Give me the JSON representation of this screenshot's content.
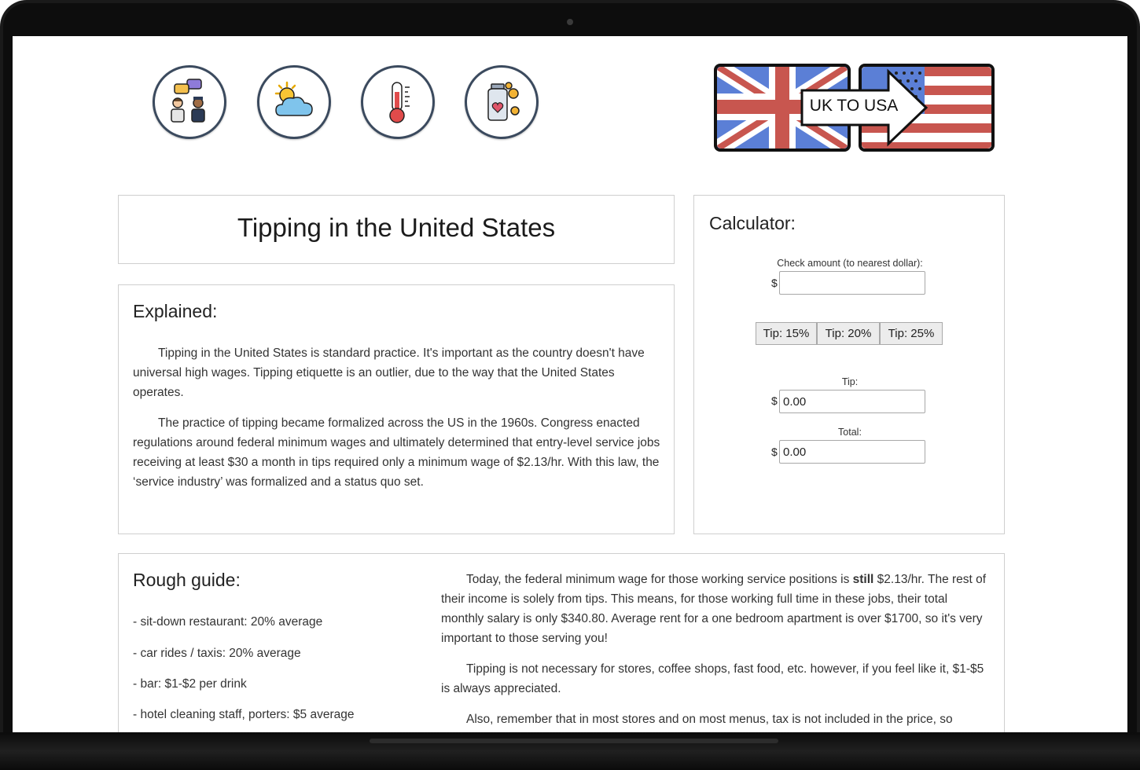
{
  "icons": [
    {
      "name": "conversation-people-icon"
    },
    {
      "name": "weather-sun-cloud-icon"
    },
    {
      "name": "thermometer-icon"
    },
    {
      "name": "tip-jar-icon"
    }
  ],
  "badge": {
    "text": "UK TO USA"
  },
  "title": "Tipping in the United States",
  "explained": {
    "heading": "Explained:",
    "paragraphs": [
      "Tipping in the United States is standard practice. It's important as the country doesn't have universal high wages. Tipping etiquette is an outlier, due to the way that the United States operates.",
      "The practice of tipping became formalized across the US in the 1960s. Congress enacted regulations around federal minimum wages and ultimately determined that entry-level service jobs receiving at least $30 a month in tips required only a minimum wage of $2.13/hr. With this law, the ‘service industry’ was formalized and a status quo set."
    ]
  },
  "calculator": {
    "heading": "Calculator:",
    "check_label": "Check amount (to nearest dollar):",
    "currency": "$",
    "check_value": "",
    "buttons": [
      "Tip: 15%",
      "Tip: 20%",
      "Tip: 25%"
    ],
    "tip_label": "Tip:",
    "tip_value": "0.00",
    "total_label": "Total:",
    "total_value": "0.00"
  },
  "guide": {
    "heading": "Rough guide:",
    "items": [
      "- sit-down restaurant: 20% average",
      "- car rides / taxis: 20% average",
      "- bar: $1-$2 per drink",
      "- hotel cleaning staff, porters: $5 average"
    ],
    "para1_before": "Today, the federal minimum wage for those working service positions is ",
    "para1_bold": "still",
    "para1_after": " $2.13/hr. The rest of their income is solely from tips. This means, for those working full time in these jobs, their total monthly salary is only $340.80. Average rent for a one bedroom apartment is over $1700, so it's very important to those serving you!",
    "para2": "Tipping is not necessary for stores, coffee shops, fast food, etc. however, if you feel like it, $1-$5 is always appreciated.",
    "para3": "Also, remember that in most stores and on most menus, tax is not included in the price, so"
  },
  "colors": {
    "flag_red": "#c8564f",
    "flag_blue": "#5b7fd6",
    "navy": "#3b4a5e",
    "border": "#cfcfcf"
  }
}
